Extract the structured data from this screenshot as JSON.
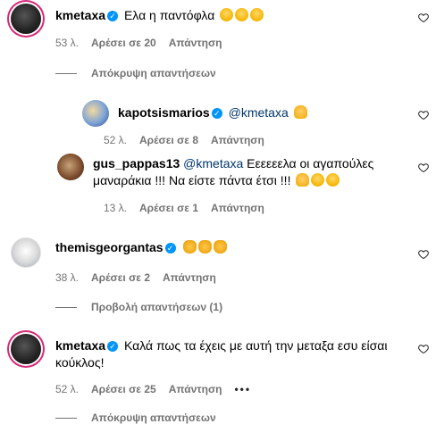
{
  "comments": [
    {
      "user": "kmetaxa",
      "text": "Ελα η παντόφλα",
      "emojis": [
        "laugh",
        "laugh",
        "laugh"
      ],
      "time": "53 λ.",
      "likes": "Αρέσει σε 20",
      "reply": "Απάντηση"
    },
    {
      "user": "kapotsismarios",
      "mention": "@kmetaxa",
      "emojis": [
        "pray"
      ],
      "time": "52 λ.",
      "likes": "Αρέσει σε 8",
      "reply": "Απάντηση"
    },
    {
      "user": "gus_pappas13",
      "mention": "@kmetaxa",
      "text_line1": "Εεεεεελα οι αγαπούλες",
      "text_line2": "μαναράκια !!! Να είστε πάντα έτσι !!!",
      "emojis": [
        "pray",
        "laugh",
        "laugh"
      ],
      "time": "13 λ.",
      "likes": "Αρέσει σε 1",
      "reply": "Απάντηση"
    },
    {
      "user": "themisgeorgantas",
      "emojis": [
        "clap",
        "clap",
        "clap"
      ],
      "time": "38 λ.",
      "likes": "Αρέσει σε 2",
      "reply": "Απάντηση"
    },
    {
      "user": "kmetaxa",
      "text_line1": "Καλά πως τα έχεις με αυτή την μεταξα εσυ είσαι",
      "text_line2": "κούκλος!",
      "time": "52 λ.",
      "likes": "Αρέσει σε 25",
      "reply": "Απάντηση",
      "more": "•••"
    }
  ],
  "toggles": {
    "hide_replies_1": "Απόκρυψη απαντήσεων",
    "view_replies": "Προβολή απαντήσεων (1)",
    "hide_replies_2": "Απόκρυψη απαντήσεων"
  },
  "colors": {
    "verified": "#0095f6",
    "meta": "#737373",
    "mention": "#00376b"
  }
}
